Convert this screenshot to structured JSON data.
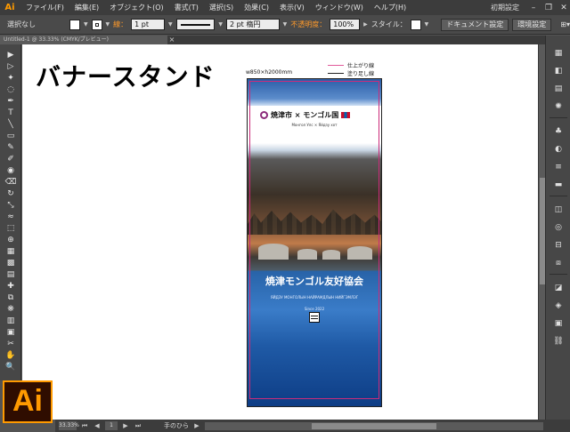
{
  "app": {
    "logo": "Ai"
  },
  "menu": {
    "items": [
      "ファイル(F)",
      "編集(E)",
      "オブジェクト(O)",
      "書式(T)",
      "選択(S)",
      "効果(C)",
      "表示(V)",
      "ウィンドウ(W)",
      "ヘルプ(H)"
    ],
    "workspace": "初期設定",
    "window_controls": [
      "minimize",
      "restore",
      "close"
    ]
  },
  "control": {
    "selection_status": "選択なし",
    "stroke_label": "線：",
    "stroke_weight": "1 pt",
    "line_style": "均等",
    "brush": "2 pt 楕円",
    "opacity_label": "不透明度：",
    "opacity_value": "100%",
    "style_label": "スタイル：",
    "doc_setup_button": "ドキュメント設定",
    "prefs_button": "環境設定"
  },
  "document": {
    "tab_title": "Untitled-1 @ 33.33% (CMYK/プレビュー)"
  },
  "canvas": {
    "heading": "バナースタンド",
    "size_label": "w850×h2000mm",
    "legend": [
      {
        "label": "仕上がり線",
        "color": "#e05a9a"
      },
      {
        "label": "塗り足し線",
        "color": "#222222"
      }
    ]
  },
  "banner": {
    "logo_text": "焼津市 × モンゴル国",
    "sub_top": "Монгол Улс  ×  Яйдзу хот",
    "title": "焼津モンゴル友好協会",
    "subtitle": "ЯЙДЗУ МОНГОЛЫН НАЙРАМДЛЫН НИЙГЭМЛЭГ",
    "since": "Since 2022"
  },
  "tools": [
    "selection-tool",
    "direct-selection-tool",
    "magic-wand-tool",
    "lasso-tool",
    "pen-tool",
    "type-tool",
    "line-tool",
    "rectangle-tool",
    "paintbrush-tool",
    "pencil-tool",
    "blob-brush-tool",
    "eraser-tool",
    "rotate-tool",
    "scale-tool",
    "warp-tool",
    "free-transform-tool",
    "shape-builder-tool",
    "perspective-grid-tool",
    "mesh-tool",
    "gradient-tool",
    "eyedropper-tool",
    "blend-tool",
    "symbol-sprayer-tool",
    "column-graph-tool",
    "artboard-tool",
    "slice-tool",
    "hand-tool",
    "zoom-tool"
  ],
  "tool_glyphs": [
    "▶",
    "▷",
    "✦",
    "◌",
    "✒",
    "T",
    "╲",
    "▭",
    "✎",
    "✐",
    "◉",
    "⌫",
    "↻",
    "⤡",
    "≈",
    "⬚",
    "⊕",
    "▦",
    "▩",
    "▤",
    "✚",
    "⧉",
    "❋",
    "▥",
    "▣",
    "✂",
    "✋",
    "🔍"
  ],
  "panels": [
    "color-panel-icon",
    "color-guide-icon",
    "swatches-icon",
    "brushes-icon",
    "symbols-icon",
    "graphic-styles-icon",
    "stroke-icon",
    "gradient-icon",
    "transparency-icon",
    "appearance-icon",
    "align-icon",
    "transform-icon",
    "pathfinder-icon",
    "layers-icon",
    "artboards-icon",
    "links-icon"
  ],
  "panel_glyphs": [
    "▦",
    "◧",
    "▤",
    "✺",
    "♣",
    "◐",
    "≡",
    "▬",
    "◫",
    "◎",
    "⊟",
    "⧈",
    "◪",
    "◈",
    "▣",
    "⛓"
  ],
  "status": {
    "zoom": "33.33%",
    "page": "1",
    "tool_name": "手のひら"
  }
}
